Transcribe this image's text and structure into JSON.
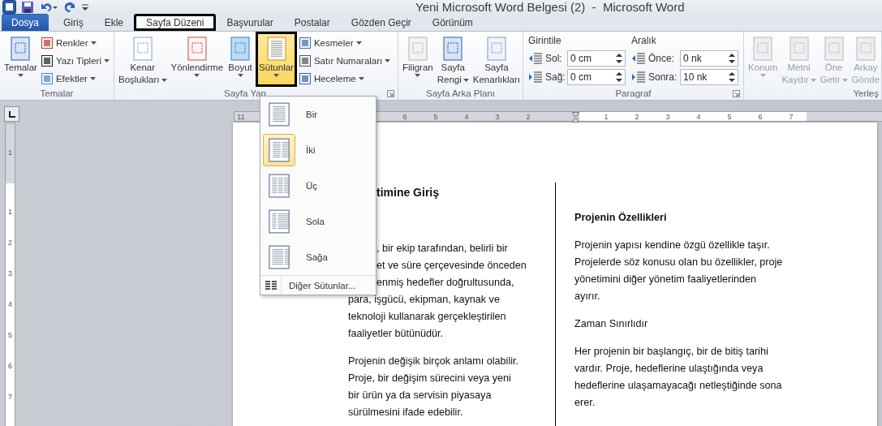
{
  "window": {
    "title": "Yeni Microsoft Word Belgesi (2)  -  Microsoft Word"
  },
  "tabs": [
    {
      "label": "Dosya",
      "kind": "file",
      "selected": false,
      "annotated": false
    },
    {
      "label": "Giriş",
      "kind": "tab",
      "selected": false,
      "annotated": false
    },
    {
      "label": "Ekle",
      "kind": "tab",
      "selected": false,
      "annotated": false
    },
    {
      "label": "Sayfa Düzeni",
      "kind": "tab",
      "selected": true,
      "annotated": true
    },
    {
      "label": "Başvurular",
      "kind": "tab",
      "selected": false,
      "annotated": false
    },
    {
      "label": "Postalar",
      "kind": "tab",
      "selected": false,
      "annotated": false
    },
    {
      "label": "Gözden Geçir",
      "kind": "tab",
      "selected": false,
      "annotated": false
    },
    {
      "label": "Görünüm",
      "kind": "tab",
      "selected": false,
      "annotated": false
    }
  ],
  "ribbon": {
    "groups": [
      {
        "label": "Temalar",
        "kind": "buttons",
        "launcher": false,
        "big_buttons": [
          {
            "lines": [
              "Temalar"
            ],
            "dropdown": true,
            "disabled": false,
            "pressed": false,
            "annotated": false
          }
        ],
        "small_buttons": [
          {
            "label": "Renkler",
            "dropdown": true
          },
          {
            "label": "Yazı Tipleri",
            "dropdown": true
          },
          {
            "label": "Efektler",
            "dropdown": true
          }
        ]
      },
      {
        "label": "Sayfa Yap",
        "kind": "buttons",
        "launcher": true,
        "big_buttons": [
          {
            "lines": [
              "Kenar",
              "Boşlukları"
            ],
            "dropdown": true,
            "disabled": false,
            "pressed": false,
            "annotated": false
          },
          {
            "lines": [
              "Yönlendirme"
            ],
            "dropdown": true,
            "disabled": false,
            "pressed": false,
            "annotated": false
          },
          {
            "lines": [
              "Boyut"
            ],
            "dropdown": true,
            "disabled": false,
            "pressed": false,
            "annotated": false
          },
          {
            "lines": [
              "Sütunlar"
            ],
            "dropdown": true,
            "disabled": false,
            "pressed": true,
            "annotated": true
          }
        ],
        "small_buttons": [
          {
            "label": "Kesmeler",
            "dropdown": true
          },
          {
            "label": "Satır Numaraları",
            "dropdown": true
          },
          {
            "label": "Heceleme",
            "dropdown": true
          }
        ]
      },
      {
        "label": "Sayfa Arka Planı",
        "kind": "buttons",
        "launcher": false,
        "big_buttons": [
          {
            "lines": [
              "Filigran"
            ],
            "dropdown": true,
            "disabled": false,
            "pressed": false,
            "annotated": false
          },
          {
            "lines": [
              "Sayfa",
              "Rengi"
            ],
            "dropdown": true,
            "disabled": false,
            "pressed": false,
            "annotated": false
          },
          {
            "lines": [
              "Sayfa",
              "Kenarlıkları"
            ],
            "dropdown": false,
            "disabled": false,
            "pressed": false,
            "annotated": false
          }
        ]
      },
      {
        "label": "Paragraf",
        "kind": "paragraph",
        "launcher": true,
        "sections": [
          {
            "title": "Girintile",
            "fields": [
              {
                "label": "Sol:",
                "value": "0 cm"
              },
              {
                "label": "Sağ:",
                "value": "0 cm"
              }
            ]
          },
          {
            "title": "Aralık",
            "fields": [
              {
                "label": "Önce:",
                "value": "0 nk"
              },
              {
                "label": "Sonra:",
                "value": "10 nk"
              }
            ]
          }
        ]
      },
      {
        "label": "Yerleş",
        "kind": "buttons",
        "launcher": false,
        "big_buttons": [
          {
            "lines": [
              "Konum"
            ],
            "dropdown": true,
            "disabled": true,
            "pressed": false,
            "annotated": false
          },
          {
            "lines": [
              "Metni",
              "Kaydır"
            ],
            "dropdown": true,
            "disabled": true,
            "pressed": false,
            "annotated": false
          },
          {
            "lines": [
              "Öne",
              "Getir"
            ],
            "dropdown": true,
            "disabled": true,
            "pressed": false,
            "annotated": false
          },
          {
            "lines": [
              "Arkay",
              "Gönde"
            ],
            "dropdown": false,
            "disabled": true,
            "pressed": false,
            "annotated": false
          }
        ]
      }
    ]
  },
  "ruler": {
    "left_labels": [
      "11"
    ],
    "mid_labels": [
      "6",
      "5",
      "4",
      "3",
      "2"
    ],
    "right_labels": [
      "1",
      "2",
      "3",
      "4",
      "5",
      "6",
      "7"
    ],
    "vertical_top_labels": [
      "1"
    ],
    "vertical_labels": [
      "1",
      "2",
      "3",
      "4",
      "5",
      "6",
      "7"
    ]
  },
  "column_menu": {
    "items": [
      {
        "label": "Bir",
        "selected": false
      },
      {
        "label": "İki",
        "selected": true
      },
      {
        "label": "Üç",
        "selected": false
      },
      {
        "label": "Sola",
        "selected": false
      },
      {
        "label": "Sağa",
        "selected": false
      }
    ],
    "footer": "Diğer Sütunlar..."
  },
  "document": {
    "columns": [
      {
        "blocks": [
          {
            "kind": "heading",
            "lines": [
              {
                "text": "timine Giriş",
                "partly_hidden": true
              }
            ]
          },
          {
            "kind": "paragraph",
            "lines": [
              {
                "text": ", bir ekip tarafından, belirli bir",
                "partly_hidden": true
              },
              {
                "text": "et ve süre çerçevesinde önceden",
                "partly_hidden": true
              },
              {
                "text": "enmiş hedefler doğrultusunda,",
                "partly_hidden": true
              },
              {
                "text": "para, işgücü, ekipman, kaynak ve",
                "partly_hidden": false
              },
              {
                "text": "teknoloji kullanarak gerçekleştirilen",
                "partly_hidden": false
              },
              {
                "text": "faaliyetler bütünüdür.",
                "partly_hidden": false
              }
            ]
          },
          {
            "kind": "paragraph",
            "lines": [
              {
                "text": "Projenin değişik birçok anlamı olabilir.",
                "partly_hidden": false
              },
              {
                "text": "Proje, bir değişim sürecini veya yeni",
                "partly_hidden": false
              },
              {
                "text": "bir ürün ya da servisin piyasaya",
                "partly_hidden": false
              },
              {
                "text": "sürülmesini ifade edebilir.",
                "partly_hidden": false
              }
            ]
          }
        ]
      },
      {
        "blocks": [
          {
            "kind": "heading",
            "lines": [
              {
                "text": "Projenin Özellikleri",
                "partly_hidden": false
              }
            ]
          },
          {
            "kind": "paragraph",
            "lines": [
              {
                "text": "Projenin yapısı kendine özgü özellikle taşır.",
                "partly_hidden": false
              },
              {
                "text": "Projelerde söz konusu olan bu özellikler, proje",
                "partly_hidden": false
              },
              {
                "text": "yönetimini diğer yönetim faaliyetlerinden",
                "partly_hidden": false
              },
              {
                "text": "ayırır.",
                "partly_hidden": false
              }
            ]
          },
          {
            "kind": "paragraph",
            "lines": [
              {
                "text": "Zaman Sınırlıdır",
                "partly_hidden": false
              }
            ]
          },
          {
            "kind": "paragraph",
            "lines": [
              {
                "text": "Her projenin bir başlangıç, bir de bitiş tarihi",
                "partly_hidden": false
              },
              {
                "text": "vardır. Proje, hedeflerine ulaştığında veya",
                "partly_hidden": false
              },
              {
                "text": "hedeflerine ulaşamayacağı netleştiğinde sona",
                "partly_hidden": false
              },
              {
                "text": "erer.",
                "partly_hidden": false
              }
            ]
          }
        ]
      }
    ]
  }
}
